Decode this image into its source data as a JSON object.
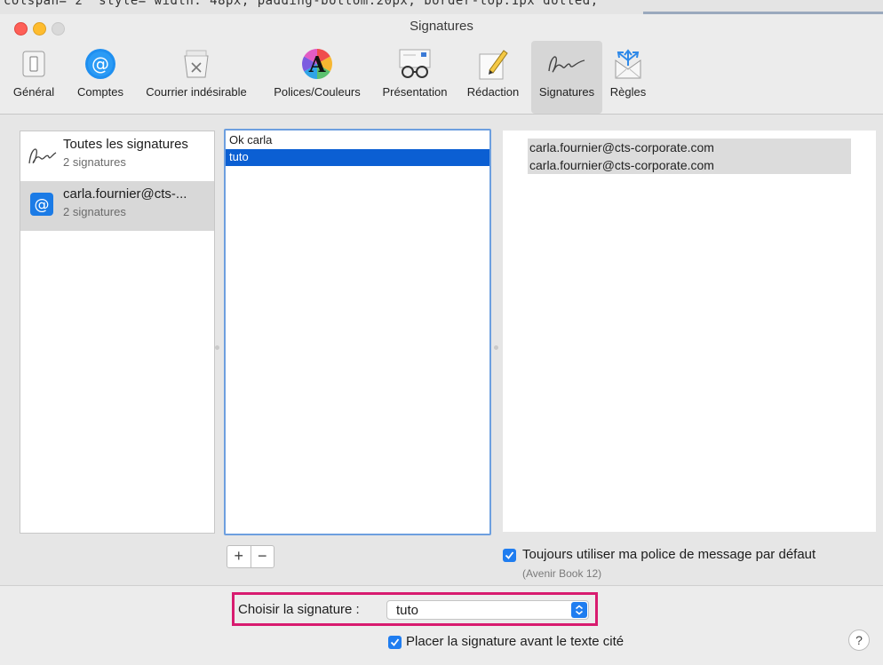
{
  "background_code": "colspan=\"2\" style=\"width: 48px; padding-bottom:20px; border-top:1px dotted;",
  "window": {
    "title": "Signatures"
  },
  "toolbar": {
    "items": [
      {
        "label": "Général",
        "icon": "switch-icon"
      },
      {
        "label": "Comptes",
        "icon": "at-icon"
      },
      {
        "label": "Courrier indésirable",
        "icon": "junk-mail-icon"
      },
      {
        "label": "Polices/Couleurs",
        "icon": "fonts-colors-icon"
      },
      {
        "label": "Présentation",
        "icon": "glasses-icon"
      },
      {
        "label": "Rédaction",
        "icon": "pencil-icon"
      },
      {
        "label": "Signatures",
        "icon": "signature-icon"
      },
      {
        "label": "Règles",
        "icon": "rules-icon"
      }
    ],
    "active": "Signatures"
  },
  "accounts": [
    {
      "name": "Toutes les signatures",
      "count": "2 signatures"
    },
    {
      "name": "carla.fournier@cts-...",
      "count": "2 signatures"
    }
  ],
  "signatures": [
    "Ok carla",
    "tuto"
  ],
  "preview": {
    "lines": [
      "carla.fournier@cts-corporate.com",
      "carla.fournier@cts-corporate.com"
    ]
  },
  "controls": {
    "add": "+",
    "remove": "−",
    "default_font_label": "Toujours utiliser ma police de message par défaut",
    "default_font_sub": "(Avenir Book 12)",
    "choose_label": "Choisir la signature :",
    "choose_value": "tuto",
    "place_before_label": "Placer la signature avant le texte cité",
    "help": "?"
  },
  "colors": {
    "accent": "#0b5fd3",
    "highlight_box": "#d81b6f"
  }
}
